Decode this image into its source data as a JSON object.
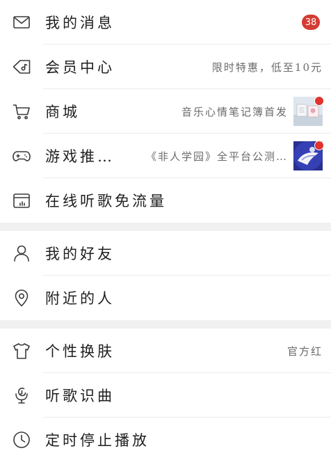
{
  "theme": {
    "accent": "#d43c33",
    "section_gap": "#f1f1f1"
  },
  "menu": {
    "group1": [
      {
        "id": "messages",
        "label": "我的消息",
        "icon": "envelope-icon",
        "badge": "38"
      },
      {
        "id": "vip",
        "label": "会员中心",
        "icon": "vip-tag-icon",
        "right_text": "限时特惠，低至10元"
      },
      {
        "id": "mall",
        "label": "商城",
        "icon": "shopping-cart-icon",
        "right_text": "音乐心情笔记簿首发",
        "thumbnail": "promo-thumbnail",
        "red_dot": true
      },
      {
        "id": "games",
        "label": "游戏推…",
        "icon": "gamepad-icon",
        "right_text": "《非人学园》全平台公测…",
        "thumbnail": "game-thumbnail",
        "red_dot": true
      },
      {
        "id": "free-data",
        "label": "在线听歌免流量",
        "icon": "sim-card-icon"
      }
    ],
    "group2": [
      {
        "id": "friends",
        "label": "我的好友",
        "icon": "person-icon"
      },
      {
        "id": "nearby",
        "label": "附近的人",
        "icon": "location-pin-icon"
      }
    ],
    "group3": [
      {
        "id": "skin",
        "label": "个性换肤",
        "icon": "tshirt-icon",
        "right_text": "官方红"
      },
      {
        "id": "recognize",
        "label": "听歌识曲",
        "icon": "microphone-icon"
      },
      {
        "id": "sleep-timer",
        "label": "定时停止播放",
        "icon": "clock-icon"
      }
    ]
  }
}
